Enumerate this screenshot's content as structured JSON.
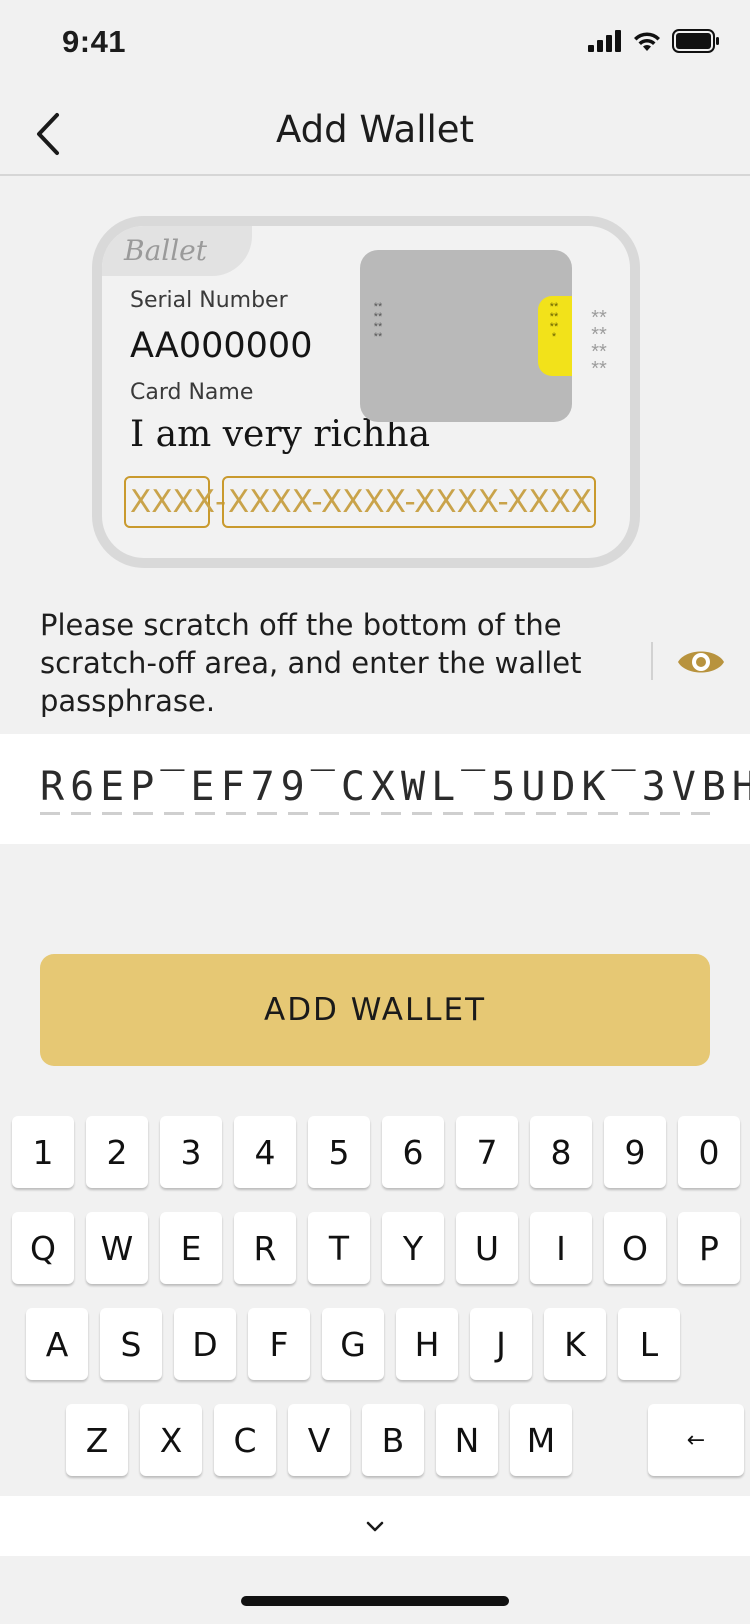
{
  "status_bar": {
    "time": "9:41",
    "icons": [
      "cellular-signal-icon",
      "wifi-icon",
      "battery-icon"
    ]
  },
  "nav": {
    "title": "Add Wallet",
    "back_icon": "chevron-left-icon"
  },
  "card": {
    "brand": "Ballet",
    "serial_label": "Serial Number",
    "serial_value": "AA000000",
    "name_label": "Card Name",
    "name_value": "I am very richha",
    "scratch_stars": "********",
    "strip_stars": "*******",
    "side_stars": "********",
    "code_first": "XXXX",
    "code_separator": "-",
    "code_rest": "XXXX-XXXX-XXXX-XXXX"
  },
  "instruction": {
    "text": "Please scratch off the bottom of the scratch-off area, and enter the wallet passphrase.",
    "reveal_icon": "eye-icon"
  },
  "passphrase": {
    "value": "R6EP‾EF79‾CXWL‾5UDK‾3VBH"
  },
  "add_button": {
    "label": "ADD WALLET"
  },
  "keyboard": {
    "rows": [
      [
        "1",
        "2",
        "3",
        "4",
        "5",
        "6",
        "7",
        "8",
        "9",
        "0"
      ],
      [
        "Q",
        "W",
        "E",
        "R",
        "T",
        "Y",
        "U",
        "I",
        "O",
        "P"
      ],
      [
        "A",
        "S",
        "D",
        "F",
        "G",
        "H",
        "J",
        "K",
        "L"
      ],
      [
        "Z",
        "X",
        "C",
        "V",
        "B",
        "N",
        "M"
      ]
    ],
    "backspace": "←",
    "collapse_icon": "chevron-down-icon"
  },
  "colors": {
    "accent": "#e6c874",
    "code_gold": "#c9a34a",
    "strip_yellow": "#f2e21a"
  }
}
